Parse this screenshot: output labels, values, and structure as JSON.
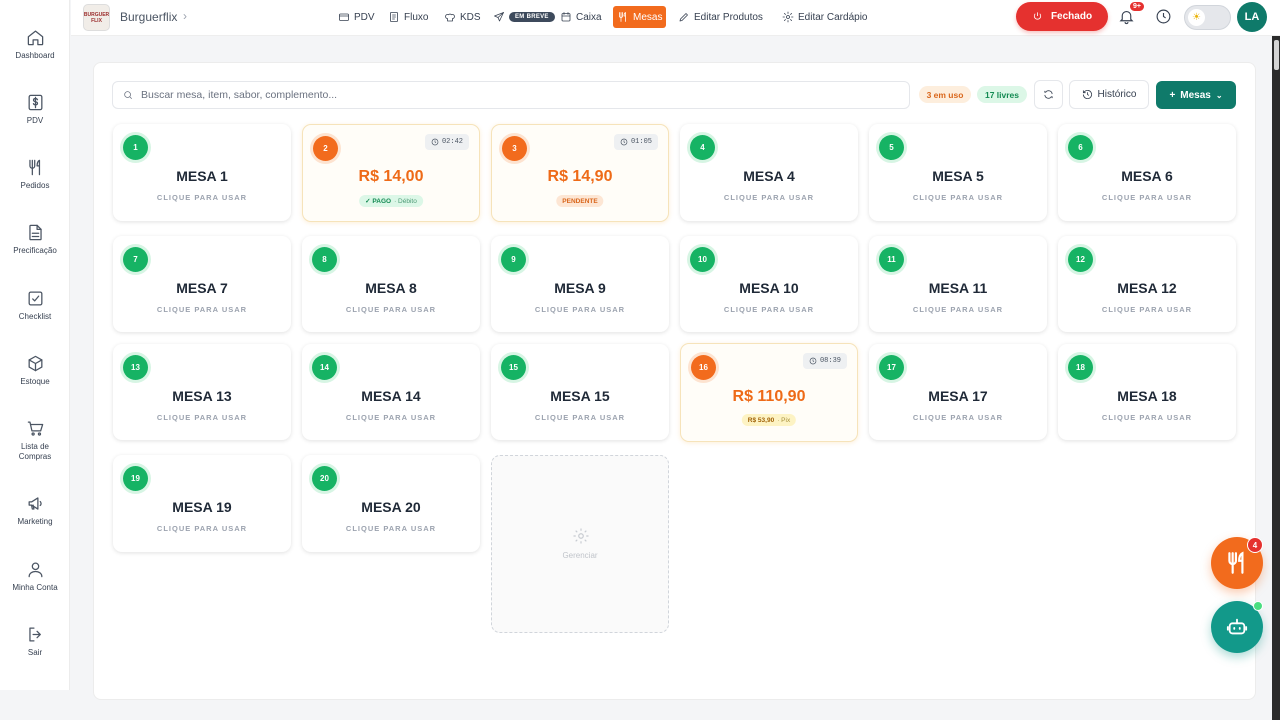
{
  "sidebar": {
    "items": [
      {
        "label": "Dashboard",
        "icon": "home-icon"
      },
      {
        "label": "PDV",
        "icon": "dollar-icon"
      },
      {
        "label": "Pedidos",
        "icon": "utensils-icon"
      },
      {
        "label": "Precificação",
        "icon": "document-icon"
      },
      {
        "label": "Checklist",
        "icon": "checkbox-icon"
      },
      {
        "label": "Estoque",
        "icon": "box-icon"
      },
      {
        "label": "Lista de Compras",
        "icon": "cart-icon"
      },
      {
        "label": "Marketing",
        "icon": "megaphone-icon"
      },
      {
        "label": "Minha Conta",
        "icon": "user-icon"
      },
      {
        "label": "Sair",
        "icon": "logout-icon"
      }
    ]
  },
  "header": {
    "logo_text": "BURGUER FLIX",
    "brand": "Burguerflix",
    "nav": [
      {
        "label": "PDV",
        "icon": "cash-register-icon"
      },
      {
        "label": "Fluxo",
        "icon": "fluxo-icon"
      },
      {
        "label": "KDS",
        "icon": "chef-hat-icon"
      },
      {
        "label": "EM BREVE",
        "icon": "send-icon"
      },
      {
        "label": "Caixa",
        "icon": "calendar-icon"
      },
      {
        "label": "Mesas",
        "icon": "utensils-icon",
        "active": true
      },
      {
        "label": "Editar Produtos",
        "icon": "pencil-icon"
      },
      {
        "label": "Editar Cardápio",
        "icon": "gear-icon"
      }
    ],
    "status_button": "Fechado",
    "notifications_badge": "9+",
    "avatar_initials": "LA"
  },
  "toolbar": {
    "search_placeholder": "Buscar mesa, item, sabor, complemento...",
    "in_use": "3 em uso",
    "free": "17 livres",
    "history_label": "Histórico",
    "add_tables_label": "Mesas"
  },
  "tables": [
    {
      "number": "1",
      "title": "MESA 1",
      "subtitle": "CLIQUE PARA USAR"
    },
    {
      "number": "2",
      "price": "R$ 14,00",
      "timer": "02:42",
      "status": "✓ PAGO",
      "method": "· Débito",
      "status_type": "pago"
    },
    {
      "number": "3",
      "price": "R$ 14,90",
      "timer": "01:05",
      "status": "PENDENTE",
      "status_type": "pendente"
    },
    {
      "number": "4",
      "title": "MESA 4",
      "subtitle": "CLIQUE PARA USAR"
    },
    {
      "number": "5",
      "title": "MESA 5",
      "subtitle": "CLIQUE PARA USAR"
    },
    {
      "number": "6",
      "title": "MESA 6",
      "subtitle": "CLIQUE PARA USAR"
    },
    {
      "number": "7",
      "title": "MESA 7",
      "subtitle": "CLIQUE PARA USAR"
    },
    {
      "number": "8",
      "title": "MESA 8",
      "subtitle": "CLIQUE PARA USAR"
    },
    {
      "number": "9",
      "title": "MESA 9",
      "subtitle": "CLIQUE PARA USAR"
    },
    {
      "number": "10",
      "title": "MESA 10",
      "subtitle": "CLIQUE PARA USAR"
    },
    {
      "number": "11",
      "title": "MESA 11",
      "subtitle": "CLIQUE PARA USAR"
    },
    {
      "number": "12",
      "title": "MESA 12",
      "subtitle": "CLIQUE PARA USAR"
    },
    {
      "number": "13",
      "title": "MESA 13",
      "subtitle": "CLIQUE PARA USAR"
    },
    {
      "number": "14",
      "title": "MESA 14",
      "subtitle": "CLIQUE PARA USAR"
    },
    {
      "number": "15",
      "title": "MESA 15",
      "subtitle": "CLIQUE PARA USAR"
    },
    {
      "number": "16",
      "price": "R$ 110,90",
      "timer": "08:39",
      "status": "R$ 53,90",
      "method": "· Pix",
      "status_type": "pix"
    },
    {
      "number": "17",
      "title": "MESA 17",
      "subtitle": "CLIQUE PARA USAR"
    },
    {
      "number": "18",
      "title": "MESA 18",
      "subtitle": "CLIQUE PARA USAR"
    },
    {
      "number": "19",
      "title": "MESA 19",
      "subtitle": "CLIQUE PARA USAR"
    },
    {
      "number": "20",
      "title": "MESA 20",
      "subtitle": "CLIQUE PARA USAR"
    }
  ],
  "manage_label": "Gerenciar",
  "fab": {
    "orders_badge": "4"
  },
  "colors": {
    "accent": "#f26b1d",
    "primary": "#0f7a6a",
    "free": "#16b364",
    "danger": "#e5312f"
  }
}
